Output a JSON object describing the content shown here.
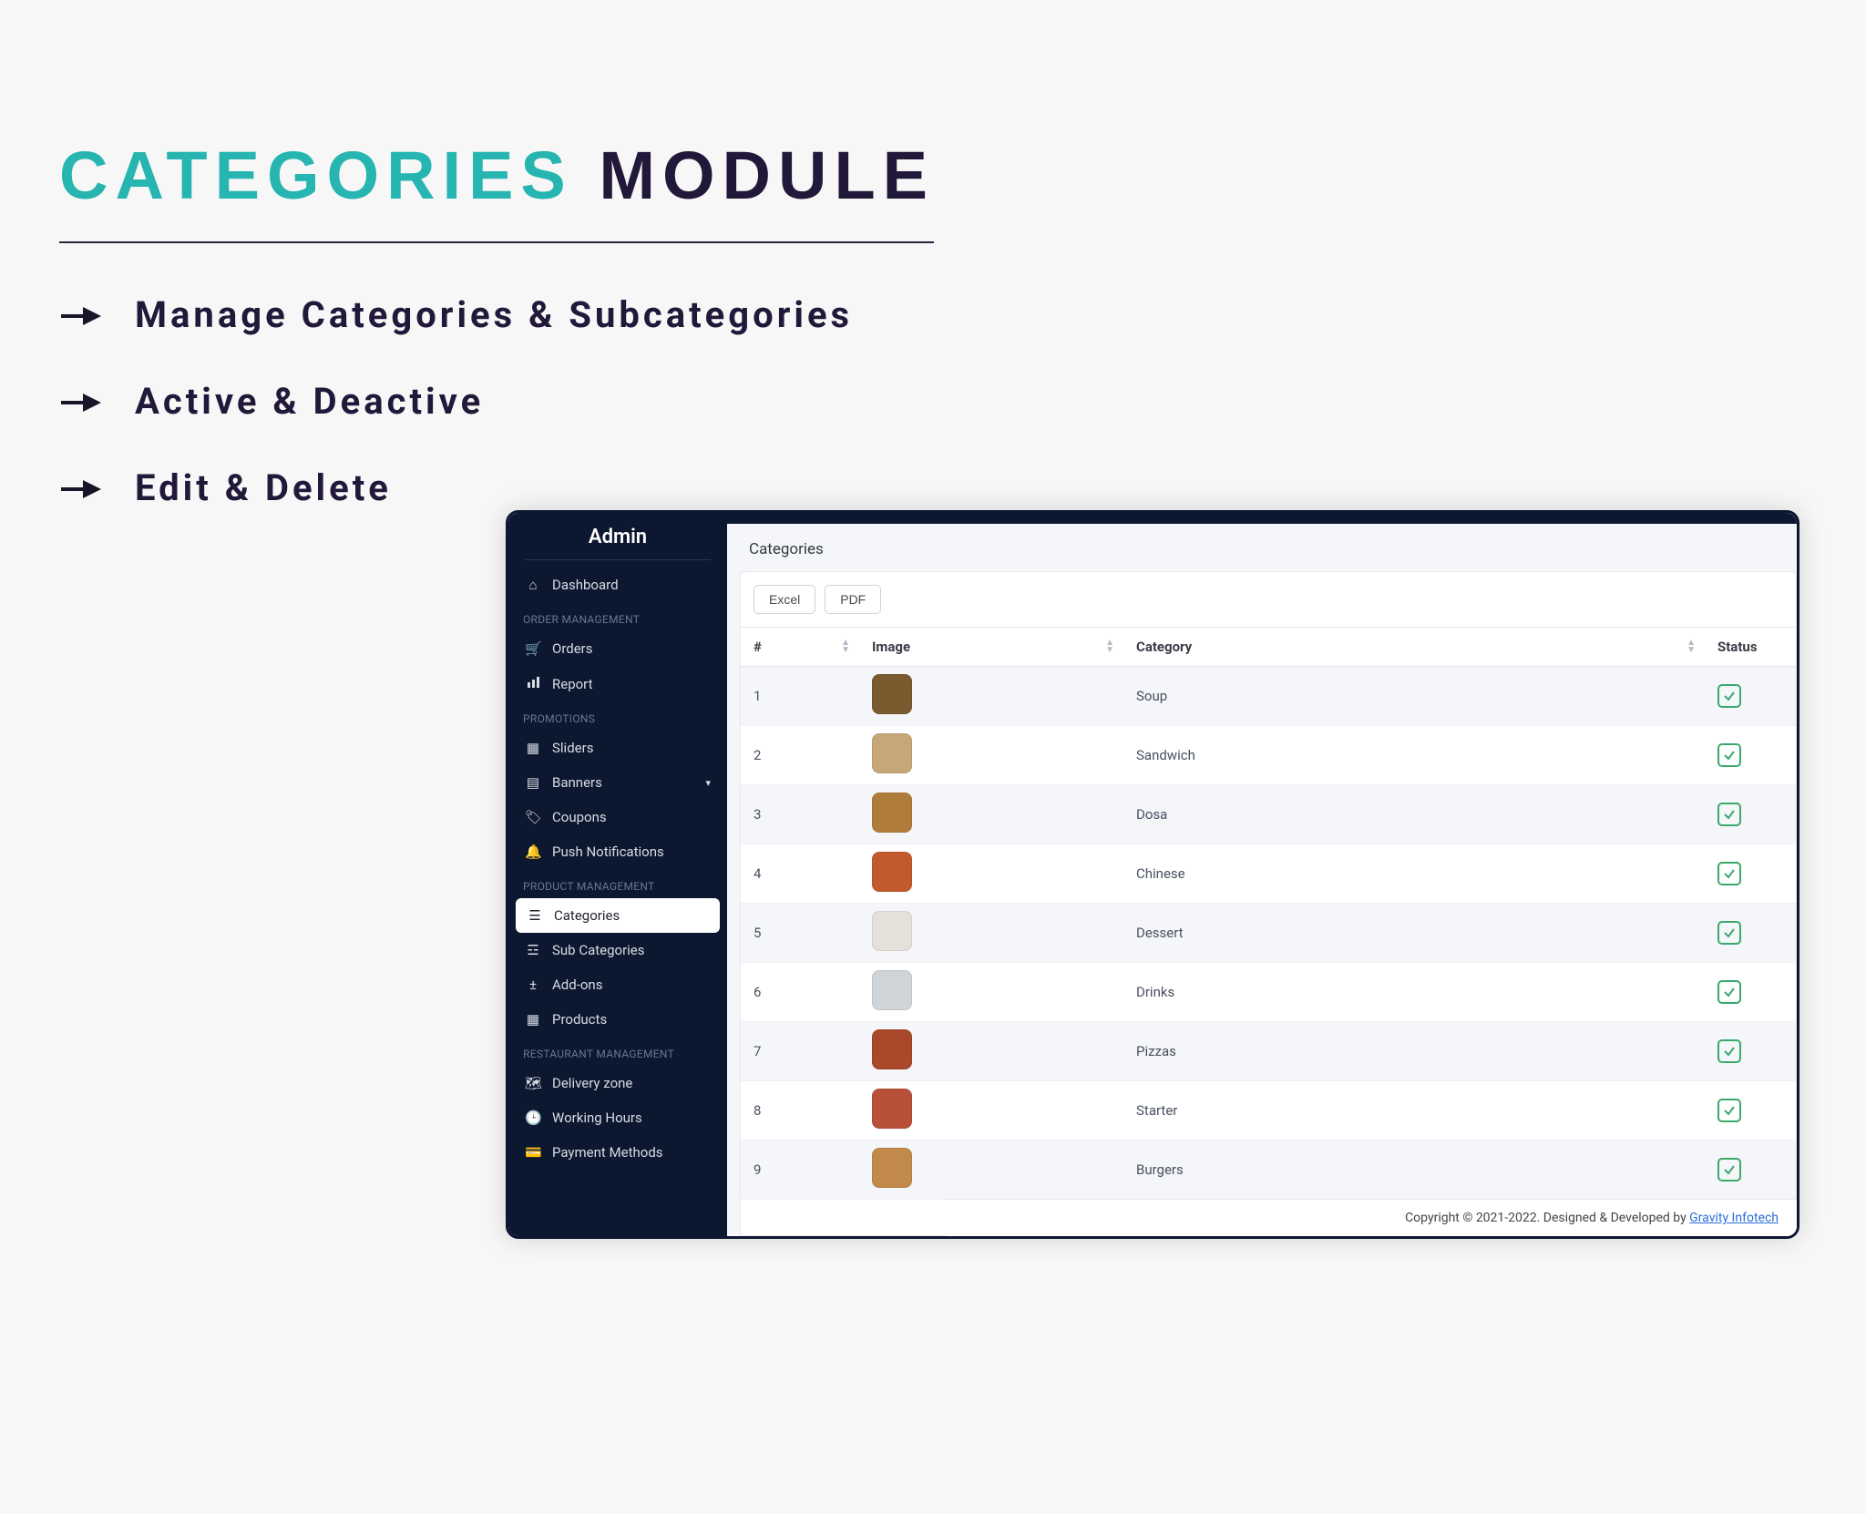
{
  "heading": {
    "word1": "CATEGORIES",
    "word2": " MODULE"
  },
  "features": [
    "Manage Categories & Subcategories",
    "Active & Deactive",
    "Edit & Delete"
  ],
  "admin": {
    "title": "Admin",
    "dashboard": "Dashboard",
    "sections": {
      "order": {
        "title": "ORDER MANAGEMENT",
        "orders": "Orders",
        "report": "Report"
      },
      "promotions": {
        "title": "PROMOTIONS",
        "sliders": "Sliders",
        "banners": "Banners",
        "coupons": "Coupons",
        "push": "Push Notifications"
      },
      "product": {
        "title": "PRODUCT MANAGEMENT",
        "categories": "Categories",
        "subcategories": "Sub Categories",
        "addons": "Add-ons",
        "products": "Products"
      },
      "restaurant": {
        "title": "RESTAURANT MANAGEMENT",
        "delivery": "Delivery zone",
        "hours": "Working Hours",
        "payment": "Payment Methods"
      }
    }
  },
  "page": {
    "title": "Categories",
    "export": {
      "excel": "Excel",
      "pdf": "PDF"
    },
    "columns": {
      "idx": "#",
      "image": "Image",
      "category": "Category",
      "status": "Status"
    },
    "rows": [
      {
        "n": "1",
        "name": "Soup",
        "thumb_color": "#7a5a2f"
      },
      {
        "n": "2",
        "name": "Sandwich",
        "thumb_color": "#c7a77a"
      },
      {
        "n": "3",
        "name": "Dosa",
        "thumb_color": "#b07c3a"
      },
      {
        "n": "4",
        "name": "Chinese",
        "thumb_color": "#c35a2e"
      },
      {
        "n": "5",
        "name": "Dessert",
        "thumb_color": "#e6e0da"
      },
      {
        "n": "6",
        "name": "Drinks",
        "thumb_color": "#cfd4d9"
      },
      {
        "n": "7",
        "name": "Pizzas",
        "thumb_color": "#a9482a"
      },
      {
        "n": "8",
        "name": "Starter",
        "thumb_color": "#b9503a"
      },
      {
        "n": "9",
        "name": "Burgers",
        "thumb_color": "#c28a4a"
      }
    ]
  },
  "footer": {
    "text": "Copyright © 2021-2022. Designed & Developed by ",
    "link": "Gravity Infotech"
  }
}
